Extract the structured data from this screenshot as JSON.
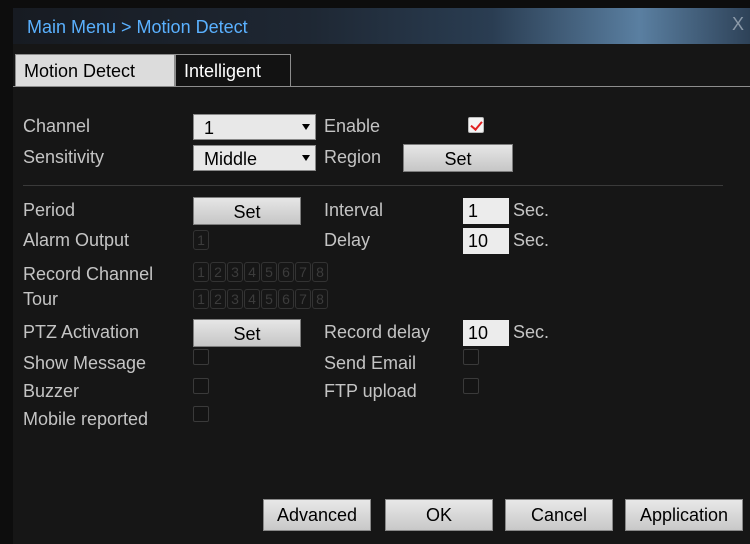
{
  "window": {
    "title": "Main Menu > Motion Detect",
    "close_label": "X"
  },
  "tabs": [
    {
      "label": "Motion Detect",
      "active": true
    },
    {
      "label": "Intelligent",
      "active": false
    }
  ],
  "fields": {
    "channel": {
      "label": "Channel",
      "value": "1"
    },
    "enable": {
      "label": "Enable",
      "checked": true
    },
    "sensitivity": {
      "label": "Sensitivity",
      "value": "Middle"
    },
    "region": {
      "label": "Region",
      "button": "Set"
    },
    "period": {
      "label": "Period",
      "button": "Set"
    },
    "interval": {
      "label": "Interval",
      "value": "1",
      "unit": "Sec."
    },
    "alarm_output": {
      "label": "Alarm Output",
      "boxes": [
        "1"
      ]
    },
    "delay": {
      "label": "Delay",
      "value": "10",
      "unit": "Sec."
    },
    "record_channel": {
      "label": "Record Channel",
      "boxes": [
        "1",
        "2",
        "3",
        "4",
        "5",
        "6",
        "7",
        "8"
      ]
    },
    "tour": {
      "label": "Tour",
      "boxes": [
        "1",
        "2",
        "3",
        "4",
        "5",
        "6",
        "7",
        "8"
      ]
    },
    "ptz_activation": {
      "label": "PTZ Activation",
      "button": "Set"
    },
    "record_delay": {
      "label": "Record delay",
      "value": "10",
      "unit": "Sec."
    },
    "show_message": {
      "label": "Show Message",
      "checked": false
    },
    "send_email": {
      "label": "Send Email",
      "checked": false
    },
    "buzzer": {
      "label": "Buzzer",
      "checked": false
    },
    "ftp_upload": {
      "label": "FTP upload",
      "checked": false
    },
    "mobile_reported": {
      "label": "Mobile reported",
      "checked": false
    }
  },
  "actions": {
    "advanced": "Advanced",
    "ok": "OK",
    "cancel": "Cancel",
    "application": "Application"
  },
  "colors": {
    "title": "#5ab1ff",
    "check_mark": "#e02020"
  }
}
